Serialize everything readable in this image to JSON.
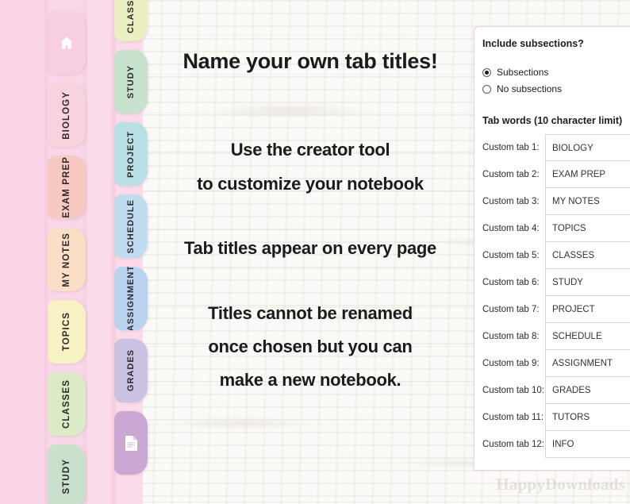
{
  "main": {
    "title": "Name your own tab titles!",
    "line1": "Use the creator tool",
    "line2": "to customize your notebook",
    "line3": "Tab titles appear on every page",
    "line4": "Titles cannot be renamed",
    "line5": "once chosen but you can",
    "line6": "make a new notebook.",
    "watermark": "HappyDownloads"
  },
  "outer_tabs": [
    {
      "label": "",
      "icon": "home-icon",
      "color": "#f8cfe2",
      "name": "home"
    },
    {
      "label": "BIOLOGY",
      "icon": "",
      "color": "#f8d3de",
      "name": "biology"
    },
    {
      "label": "EXAM PREP",
      "icon": "",
      "color": "#f7c9c2",
      "name": "exam-prep"
    },
    {
      "label": "MY NOTES",
      "icon": "",
      "color": "#fadfc6",
      "name": "my-notes"
    },
    {
      "label": "TOPICS",
      "icon": "",
      "color": "#f7f2c4",
      "name": "topics"
    },
    {
      "label": "CLASSES",
      "icon": "",
      "color": "#dbebc6",
      "name": "classes"
    },
    {
      "label": "STUDY",
      "icon": "",
      "color": "#c9e0cd",
      "name": "study"
    }
  ],
  "inner_tabs": [
    {
      "label": "CLASSES",
      "icon": "",
      "color": "#eaeec0",
      "name": "classes"
    },
    {
      "label": "STUDY",
      "icon": "",
      "color": "#c6e2cd",
      "name": "study"
    },
    {
      "label": "PROJECT",
      "icon": "",
      "color": "#b9e0e4",
      "name": "project"
    },
    {
      "label": "SCHEDULE",
      "icon": "",
      "color": "#bfdcf1",
      "name": "schedule"
    },
    {
      "label": "ASSIGNMENT",
      "icon": "",
      "color": "#b9d3ee",
      "name": "assignment"
    },
    {
      "label": "GRADES",
      "icon": "",
      "color": "#cbc1e2",
      "name": "grades"
    },
    {
      "label": "",
      "icon": "page-icon",
      "color": "#cba8d4",
      "name": "page"
    }
  ],
  "panel": {
    "title": "Include subsections?",
    "radios": [
      {
        "label": "Subsections",
        "checked": true
      },
      {
        "label": "No subsections",
        "checked": false
      }
    ],
    "section_title": "Tab words (10 character limit)",
    "fields": [
      {
        "label": "Custom tab 1:",
        "value": "BIOLOGY"
      },
      {
        "label": "Custom tab 2:",
        "value": "EXAM PREP"
      },
      {
        "label": "Custom tab 3:",
        "value": "MY NOTES"
      },
      {
        "label": "Custom tab 4:",
        "value": "TOPICS"
      },
      {
        "label": "Custom tab 5:",
        "value": "CLASSES"
      },
      {
        "label": "Custom tab 6:",
        "value": "STUDY"
      },
      {
        "label": "Custom tab 7:",
        "value": "PROJECT"
      },
      {
        "label": "Custom tab 8:",
        "value": "SCHEDULE"
      },
      {
        "label": "Custom tab 9:",
        "value": "ASSIGNMENT"
      },
      {
        "label": "Custom tab 10:",
        "value": "GRADES"
      },
      {
        "label": "Custom tab 11:",
        "value": "TUTORS"
      },
      {
        "label": "Custom tab 12:",
        "value": "INFO"
      }
    ]
  }
}
